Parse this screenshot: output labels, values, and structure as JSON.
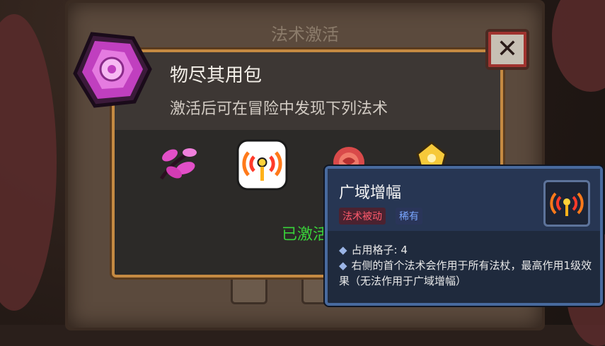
{
  "screen_title": "法术激活",
  "pack": {
    "name": "物尽其用包",
    "description": "激活后可在冒险中发现下列法术",
    "status": "已激活"
  },
  "close_button": {
    "label": "✕"
  },
  "spells": [
    {
      "icon": "pink-leaf-icon"
    },
    {
      "icon": "signal-broadcast-icon"
    },
    {
      "icon": "red-rose-icon"
    },
    {
      "icon": "golden-totem-icon"
    }
  ],
  "tooltip": {
    "title": "广域增幅",
    "tags": [
      "法术被动",
      "稀有"
    ],
    "line1": "占用格子: 4",
    "line2": "右侧的首个法术会作用于所有法杖，最高作用1级效果（无法作用于广域增幅）",
    "icon": "signal-broadcast-icon"
  },
  "colors": {
    "panel_border": "#c58a42",
    "activated": "#39d23a",
    "tag_passive": "#ff5a6c",
    "tag_rare": "#79a6ff"
  }
}
